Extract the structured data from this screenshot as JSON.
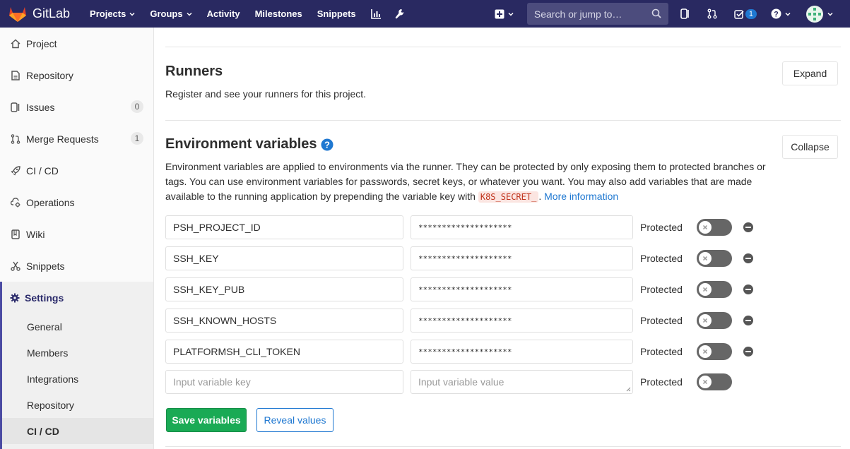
{
  "topnav": {
    "brand": "GitLab",
    "links": [
      {
        "label": "Projects",
        "dropdown": true
      },
      {
        "label": "Groups",
        "dropdown": true
      },
      {
        "label": "Activity",
        "dropdown": false
      },
      {
        "label": "Milestones",
        "dropdown": false
      },
      {
        "label": "Snippets",
        "dropdown": false
      }
    ],
    "search_placeholder": "Search or jump to…",
    "todo_count": "1",
    "bg_color": "#292961"
  },
  "sidebar": {
    "items": [
      {
        "label": "Project",
        "icon": "home-icon"
      },
      {
        "label": "Repository",
        "icon": "doc-icon"
      },
      {
        "label": "Issues",
        "icon": "issues-icon",
        "count": "0"
      },
      {
        "label": "Merge Requests",
        "icon": "merge-request-icon",
        "count": "1"
      },
      {
        "label": "CI / CD",
        "icon": "rocket-icon"
      },
      {
        "label": "Operations",
        "icon": "cloud-gear-icon"
      },
      {
        "label": "Wiki",
        "icon": "book-icon"
      },
      {
        "label": "Snippets",
        "icon": "scissors-icon"
      }
    ],
    "settings": {
      "label": "Settings",
      "sub_items": [
        "General",
        "Members",
        "Integrations",
        "Repository",
        "CI / CD"
      ]
    }
  },
  "runners": {
    "title": "Runners",
    "description": "Register and see your runners for this project.",
    "expand_label": "Expand"
  },
  "env": {
    "title": "Environment variables",
    "collapse_label": "Collapse",
    "description": "Environment variables are applied to environments via the runner. They can be protected by only exposing them to protected branches or tags. You can use environment variables for passwords, secret keys, or whatever you want. You may also add variables that are made available to the running application by prepending the variable key with",
    "code_prefix": "K8S_SECRET_",
    "more_info": "More information",
    "protected_label": "Protected",
    "variables": [
      {
        "key": "PSH_PROJECT_ID",
        "value": "********************"
      },
      {
        "key": "SSH_KEY",
        "value": "********************"
      },
      {
        "key": "SSH_KEY_PUB",
        "value": "********************"
      },
      {
        "key": "SSH_KNOWN_HOSTS",
        "value": "********************"
      },
      {
        "key": "PLATFORMSH_CLI_TOKEN",
        "value": "********************"
      }
    ],
    "new_key_placeholder": "Input variable key",
    "new_value_placeholder": "Input variable value",
    "save_label": "Save variables",
    "reveal_label": "Reveal values"
  }
}
